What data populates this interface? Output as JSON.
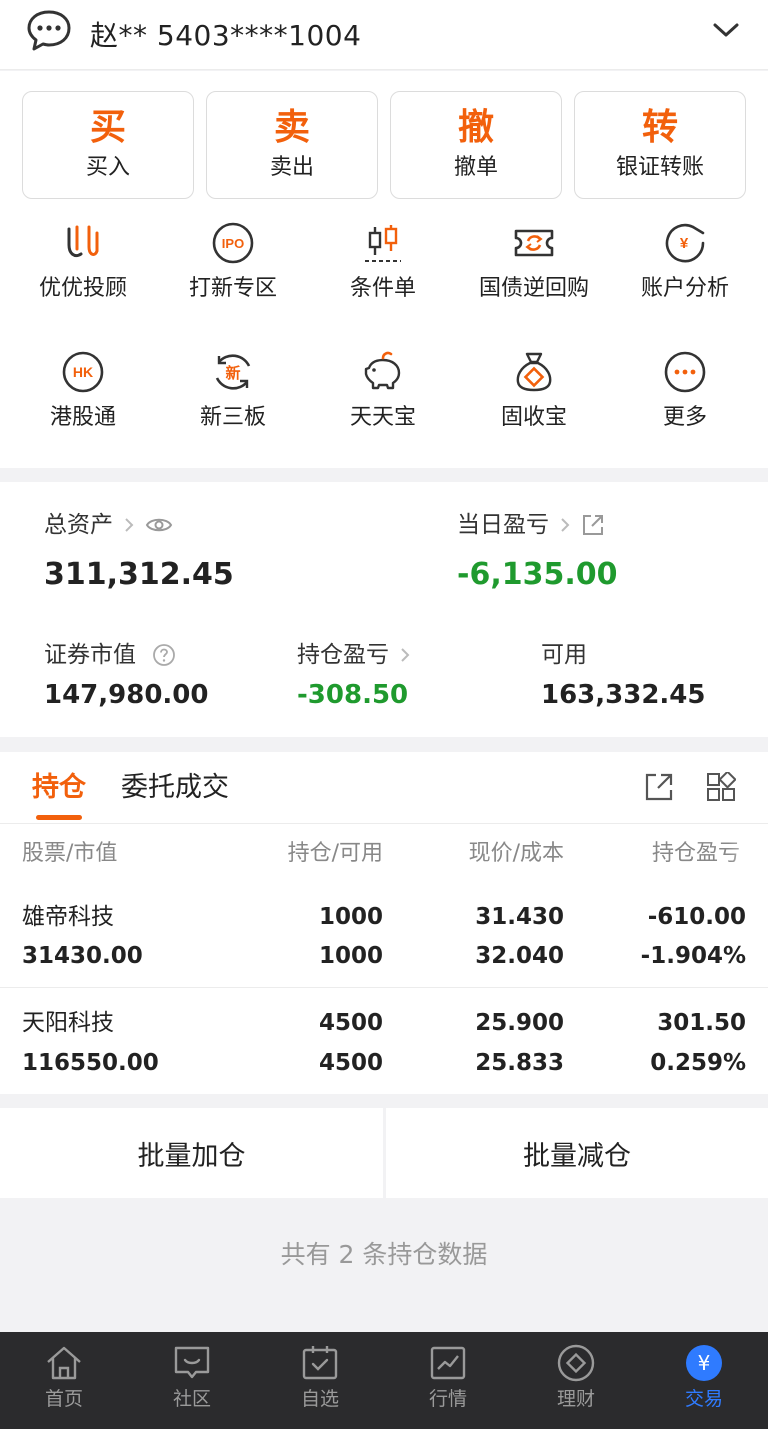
{
  "header": {
    "account": "赵** 5403****1004"
  },
  "actions": [
    {
      "big": "买",
      "label": "买入"
    },
    {
      "big": "卖",
      "label": "卖出"
    },
    {
      "big": "撤",
      "label": "撤单"
    },
    {
      "big": "转",
      "label": "银证转账"
    }
  ],
  "grid": [
    {
      "label": "优优投顾",
      "icon": "uu-advisor-icon"
    },
    {
      "label": "打新专区",
      "icon": "ipo-icon",
      "icon_text": "IPO"
    },
    {
      "label": "条件单",
      "icon": "candlestick-icon"
    },
    {
      "label": "国债逆回购",
      "icon": "repo-ticket-icon"
    },
    {
      "label": "账户分析",
      "icon": "yen-chart-icon",
      "icon_text": "¥"
    },
    {
      "label": "港股通",
      "icon": "hk-icon",
      "icon_text": "HK"
    },
    {
      "label": "新三板",
      "icon": "new-board-icon",
      "icon_text": "新"
    },
    {
      "label": "天天宝",
      "icon": "piggy-bank-icon"
    },
    {
      "label": "固收宝",
      "icon": "money-bag-icon"
    },
    {
      "label": "更多",
      "icon": "more-icon"
    }
  ],
  "assets": {
    "total_label": "总资产",
    "total_value": "311,312.45",
    "daily_label": "当日盈亏",
    "daily_value": "-6,135.00",
    "market_label": "证券市值",
    "market_value": "147,980.00",
    "pnl_label": "持仓盈亏",
    "pnl_value": "-308.50",
    "avail_label": "可用",
    "avail_value": "163,332.45"
  },
  "tabs": {
    "holdings": "持仓",
    "orders": "委托成交"
  },
  "table": {
    "headers": [
      "股票/市值",
      "持仓/可用",
      "现价/成本",
      "持仓盈亏"
    ],
    "rows": [
      {
        "name": "雄帝科技",
        "mv": "31430.00",
        "hold": "1000",
        "avail": "1000",
        "price": "31.430",
        "cost": "32.040",
        "pnl": "-610.00",
        "pnl_pct": "-1.904%",
        "trend": "down"
      },
      {
        "name": "天阳科技",
        "mv": "116550.00",
        "hold": "4500",
        "avail": "4500",
        "price": "25.900",
        "cost": "25.833",
        "pnl": "301.50",
        "pnl_pct": "0.259%",
        "trend": "up"
      }
    ]
  },
  "batch": {
    "add": "批量加仓",
    "reduce": "批量减仓"
  },
  "count_text": "共有 2 条持仓数据",
  "nav": [
    {
      "label": "首页",
      "icon": "home-icon"
    },
    {
      "label": "社区",
      "icon": "community-icon"
    },
    {
      "label": "自选",
      "icon": "watchlist-icon"
    },
    {
      "label": "行情",
      "icon": "market-icon"
    },
    {
      "label": "理财",
      "icon": "wealth-icon"
    },
    {
      "label": "交易",
      "icon": "trade-icon",
      "icon_text": "¥",
      "active": true
    }
  ],
  "colors": {
    "accent": "#f2600c",
    "down": "#1f9a2e",
    "up": "#e0191f",
    "nav_active": "#2f7bff"
  }
}
